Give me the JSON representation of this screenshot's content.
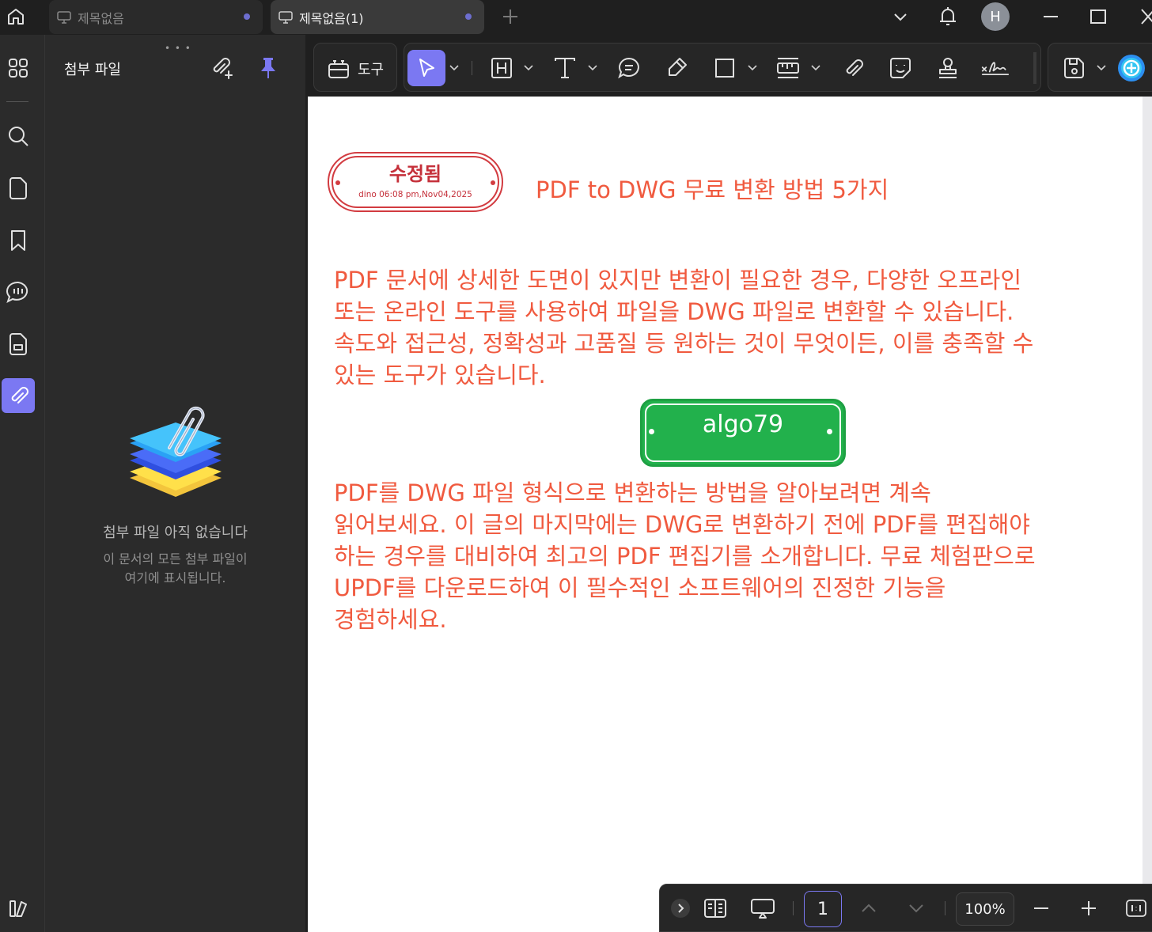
{
  "tabs": [
    {
      "label": "제목없음",
      "active": false
    },
    {
      "label": "제목없음(1)",
      "active": true
    }
  ],
  "user": {
    "avatar_initial": "H"
  },
  "panel": {
    "title": "첨부 파일",
    "empty_title": "첨부 파일 아직 없습니다",
    "empty_desc_line1": "이 문서의 모든 첨부 파일이",
    "empty_desc_line2": "여기에 표시됩니다."
  },
  "toolbar": {
    "tools_label": "도구"
  },
  "document": {
    "title": "PDF to DWG 무료 변환 방법 5가지",
    "para1": [
      "PDF 문서에 상세한 도면이 있지만 변환이 필요한 경우, 다양한 오프라인",
      "또는 온라인 도구를 사용하여 파일을 DWG 파일로 변환할 수 있습니다.",
      "속도와 접근성, 정확성과 고품질 등 원하는 것이 무엇이든, 이를 충족할 수",
      "있는 도구가 있습니다."
    ],
    "para2": [
      "PDF를 DWG 파일 형식으로 변환하는 방법을 알아보려면 계속",
      "읽어보세요. 이 글의 마지막에는 DWG로 변환하기 전에 PDF를 편집해야",
      "하는 경우를 대비하여 최고의 PDF 편집기를 소개합니다. 무료 체험판으로",
      "UPDF를 다운로드하여 이 필수적인 소프트웨어의 진정한 기능을",
      "경험하세요."
    ],
    "stamp_red": {
      "title": "수정됨",
      "subtitle": "dino 06:08 pm,Nov04,2025",
      "color": "#d23b40"
    },
    "stamp_green": {
      "title": "algo79",
      "color": "#22b14c"
    },
    "text_color": "#f05a3f"
  },
  "bottombar": {
    "page_number": "1",
    "zoom": "100%"
  },
  "colors": {
    "accent": "#7b78f2",
    "background": "#1f1f1f",
    "panel": "#2b2b2b"
  }
}
